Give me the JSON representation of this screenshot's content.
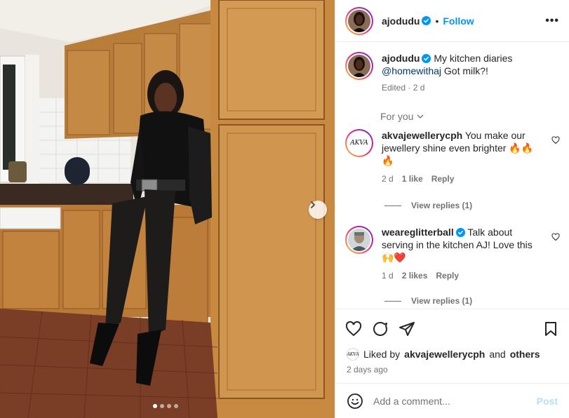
{
  "post": {
    "username": "ajodudu",
    "follow_label": "Follow",
    "separator": "•",
    "more_label": "•••",
    "caption": {
      "username": "ajodudu",
      "text_before": "My kitchen diaries",
      "mention": "@homewithaj",
      "text_after": "Got milk?!",
      "edited": "Edited",
      "age": "2 d"
    },
    "photo": {
      "slide_count": 4,
      "active_slide": 1
    }
  },
  "comments_filter": "For you",
  "comments": [
    {
      "username": "akvajewellerycph",
      "avatar_text": "AKVA",
      "text": "You make our jewellery shine even brighter 🔥🔥🔥",
      "age": "2 d",
      "likes": "1 like",
      "reply_label": "Reply",
      "view_replies": "View replies (1)"
    },
    {
      "username": "weareglitterball",
      "verified": true,
      "text": "Talk about serving in the kitchen AJ! Love this 🙌❤️",
      "age": "1 d",
      "likes": "2 likes",
      "reply_label": "Reply",
      "view_replies": "View replies (1)"
    }
  ],
  "likes": {
    "prefix": "Liked by",
    "user": "akvajewellerycph",
    "and": "and",
    "others": "others",
    "avatar_text": "AKVA",
    "time": "2 days ago"
  },
  "add_comment": {
    "placeholder": "Add a comment...",
    "post_label": "Post"
  },
  "colors": {
    "link": "#0095f6",
    "mention": "#00376b",
    "muted": "#737373",
    "verified": "#0095f6",
    "post_disabled": "#b2dffc"
  }
}
